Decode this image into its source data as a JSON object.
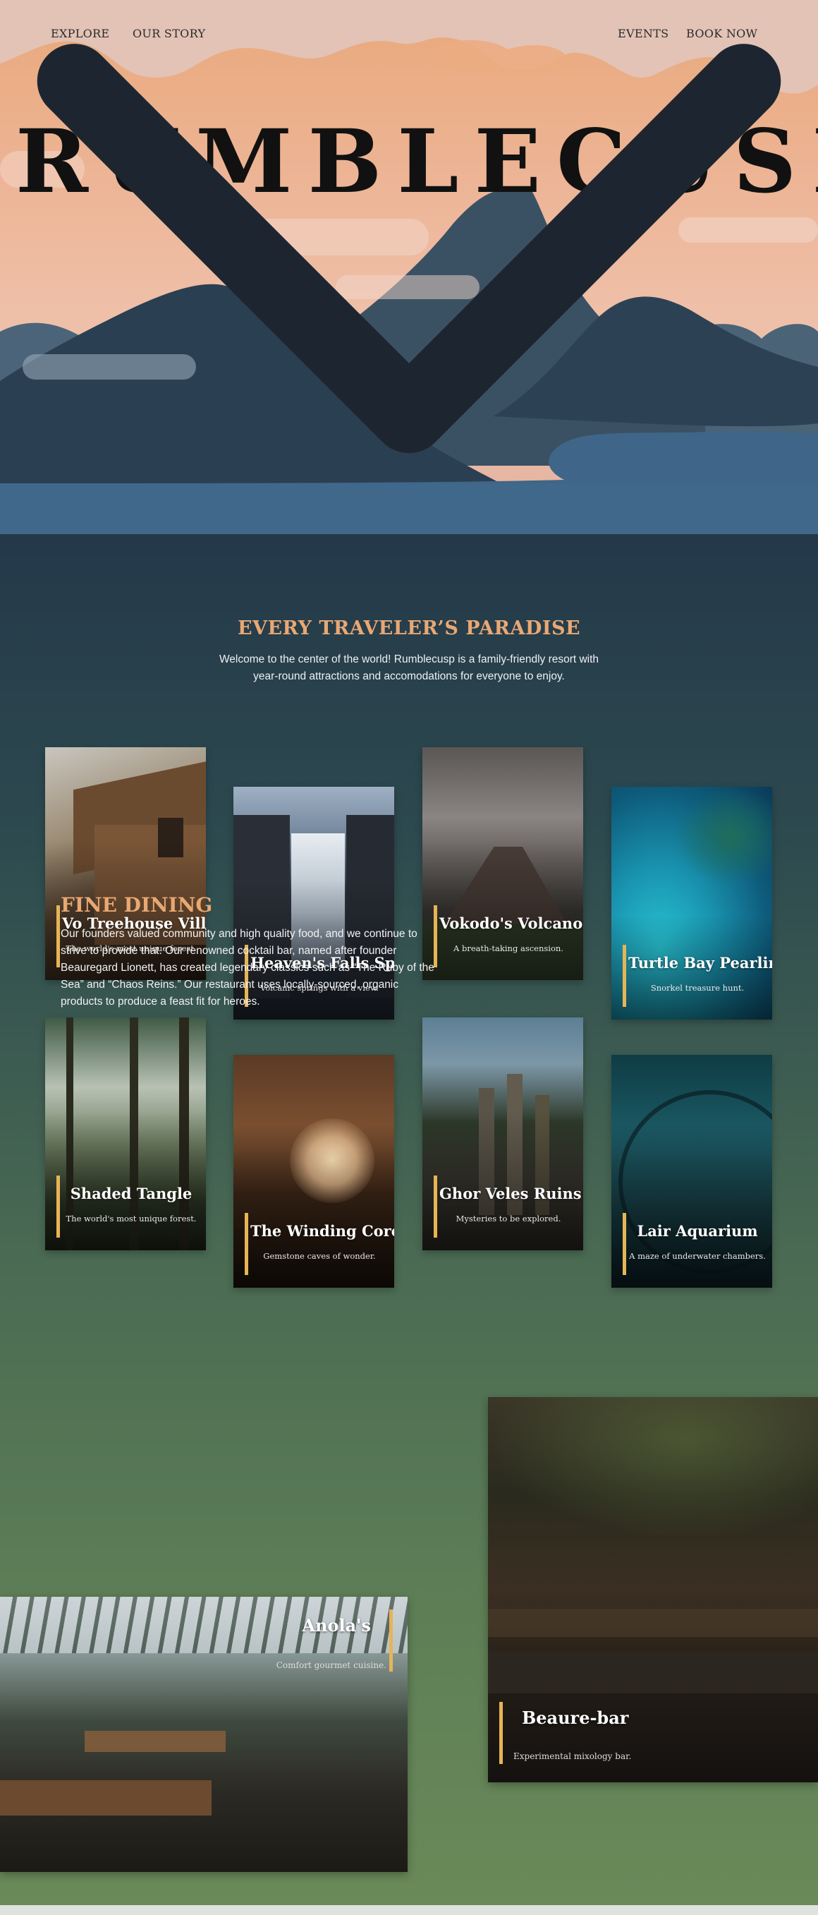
{
  "nav": {
    "explore": "EXPLORE",
    "our_story": "OUR STORY",
    "events": "EVENTS",
    "book_now": "BOOK NOW"
  },
  "hero": {
    "brand": "RUMBLECUSP",
    "scroll_icon": "chevron-down-icon"
  },
  "intro": {
    "title": "EVERY TRAVELER’S PARADISE",
    "lede": "Welcome to the center of the world! Rumblecusp is a family-friendly resort with year-round attractions and accomodations for everyone to enjoy."
  },
  "attractions": [
    {
      "title": "Vo Treehouse Villas",
      "subtitle": "The world's most unique forest."
    },
    {
      "title": "Heaven's Falls Spa",
      "subtitle": "Volcanic springs with a view."
    },
    {
      "title": "Vokodo's Volcano",
      "subtitle": "A breath-taking ascension."
    },
    {
      "title": "Turtle Bay Pearling",
      "subtitle": "Snorkel treasure hunt."
    },
    {
      "title": "Shaded Tangle",
      "subtitle": "The world's most unique forest."
    },
    {
      "title": "The Winding Core",
      "subtitle": "Gemstone caves of wonder."
    },
    {
      "title": "Ghor Veles Ruins",
      "subtitle": "Mysteries to be explored."
    },
    {
      "title": "Lair Aquarium",
      "subtitle": "A maze of underwater chambers."
    }
  ],
  "dining": {
    "title": "FINE DINING",
    "text": "Our founders valued community and high quality food, and we continue to strive to provide that. Our renowned cocktail bar, named after founder Beauregard Lionett, has created legendary classics such as “The Ruby of the Sea” and “Chaos Reins.” Our restaurant uses locally-sourced, organic products to produce a feast fit for heroes.",
    "venues": [
      {
        "title": "Anola's",
        "subtitle": "Comfort gourmet cuisine."
      },
      {
        "title": "Beaure-bar",
        "subtitle": "Experimental mixology bar."
      }
    ]
  },
  "colors": {
    "accent": "#e9a873",
    "bar": "#e7b456",
    "sky": "#edb597",
    "mountain": "#2e4558",
    "water": "#3f6688",
    "section_top": "#243849",
    "section_bottom": "#6a8a59"
  }
}
